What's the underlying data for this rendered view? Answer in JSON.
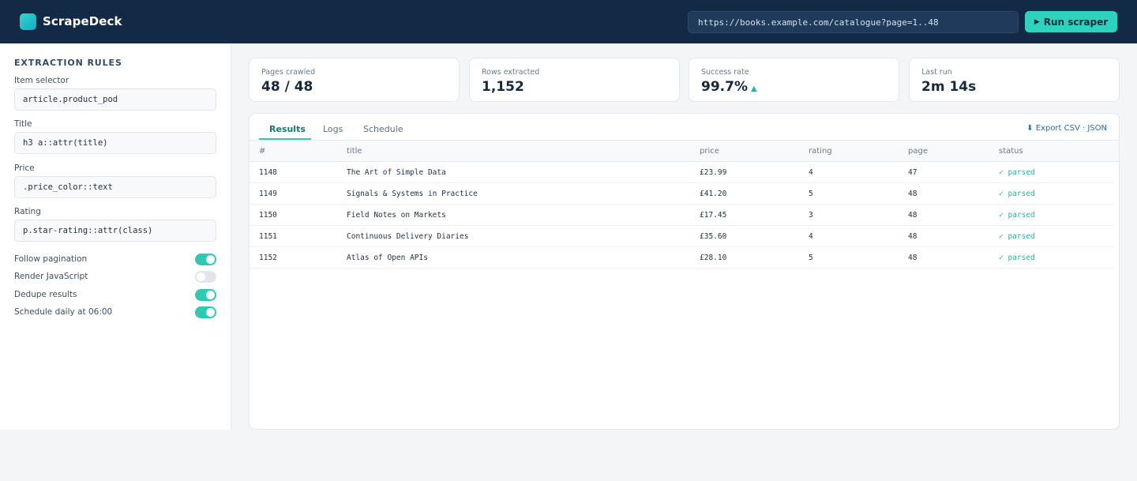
{
  "app": {
    "name": "ScrapeDeck"
  },
  "header": {
    "url_value": "https://books.example.com/catalogue?page=1..48",
    "run_label": "Run scraper",
    "run_icon": "▶"
  },
  "sidebar": {
    "title": "EXTRACTION RULES",
    "fields": [
      {
        "label": "Item selector",
        "value": "article.product_pod"
      },
      {
        "label": "Title",
        "value": "h3 a::attr(title)"
      },
      {
        "label": "Price",
        "value": ".price_color::text"
      },
      {
        "label": "Rating",
        "value": "p.star-rating::attr(class)"
      }
    ],
    "toggles": [
      {
        "label": "Follow pagination",
        "on": true
      },
      {
        "label": "Render JavaScript",
        "on": false
      },
      {
        "label": "Dedupe results",
        "on": true
      },
      {
        "label": "Schedule daily at 06:00",
        "on": true
      }
    ]
  },
  "stats": [
    {
      "label": "Pages crawled",
      "value": "48 / 48"
    },
    {
      "label": "Rows extracted",
      "value": "1,152"
    },
    {
      "label": "Success rate",
      "value": "99.7%",
      "trend": "▲"
    },
    {
      "label": "Last run",
      "value": "2m 14s"
    }
  ],
  "results": {
    "tabs": [
      "Results",
      "Logs",
      "Schedule"
    ],
    "active_tab": "Results",
    "export_label": "⬇ Export CSV · JSON",
    "columns": [
      "#",
      "title",
      "price",
      "rating",
      "page",
      "status"
    ],
    "rows": [
      [
        "1148",
        "The Art of Simple Data",
        "£23.99",
        "4",
        "47",
        "✓ parsed"
      ],
      [
        "1149",
        "Signals & Systems in Practice",
        "£41.20",
        "5",
        "48",
        "✓ parsed"
      ],
      [
        "1150",
        "Field Notes on Markets",
        "£17.45",
        "3",
        "48",
        "✓ parsed"
      ],
      [
        "1151",
        "Continuous Delivery Diaries",
        "£35.60",
        "4",
        "48",
        "✓ parsed"
      ],
      [
        "1152",
        "Atlas of Open APIs",
        "£28.10",
        "5",
        "48",
        "✓ parsed"
      ]
    ]
  },
  "colors": {
    "header_bg": "#132a46",
    "accent": "#2ed3bd",
    "status_ok": "#2ab39c",
    "link": "#1f6fa8"
  }
}
